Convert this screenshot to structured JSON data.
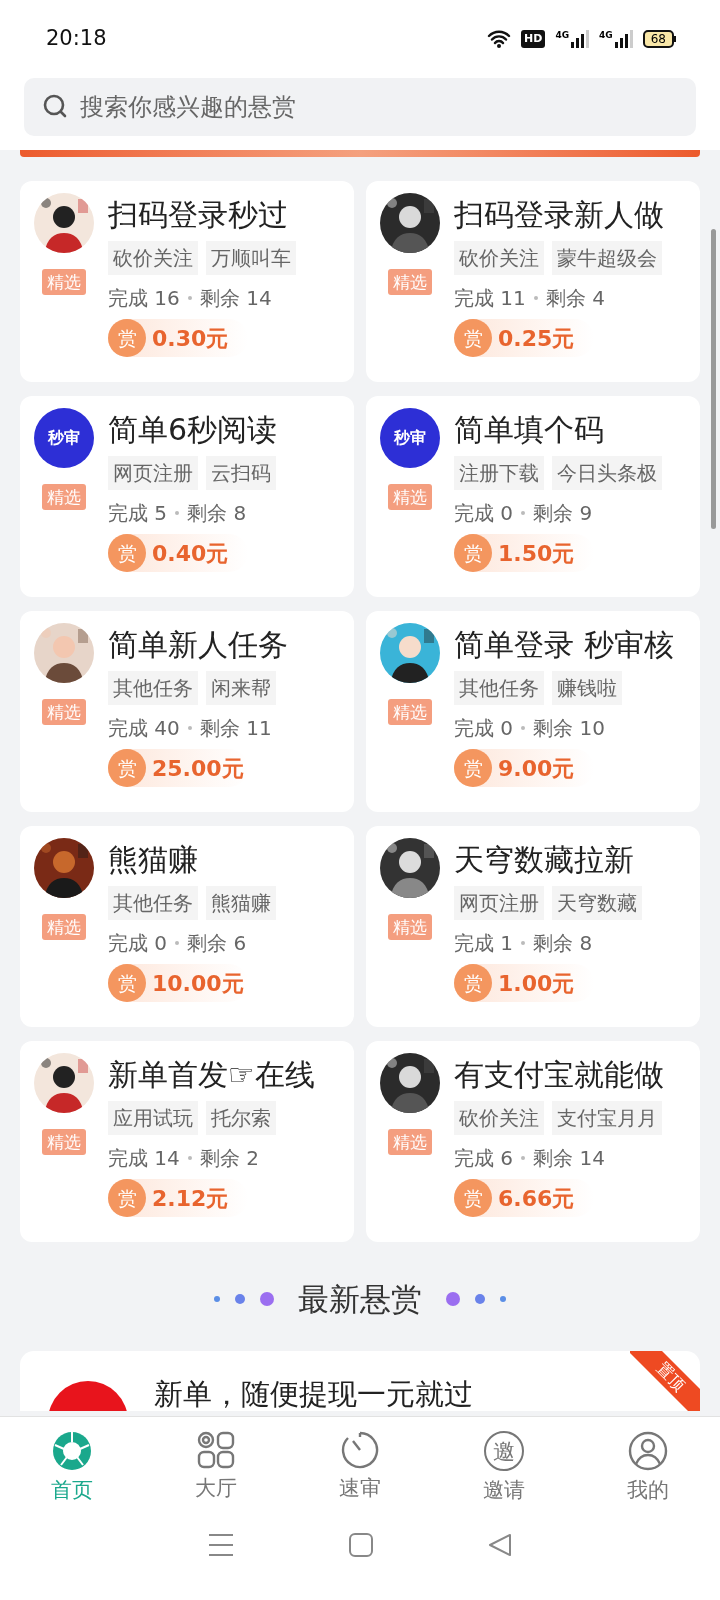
{
  "status_bar": {
    "time": "20:18",
    "battery": "68",
    "network_labels": [
      "4G",
      "4G"
    ],
    "hd_label": "HD"
  },
  "search": {
    "placeholder": "搜索你感兴趣的悬赏"
  },
  "cards": [
    {
      "title": "扫码登录秒过",
      "tags": [
        "砍价关注",
        "万顺叫车"
      ],
      "badge": "精选",
      "done": "完成 16",
      "remaining": "剩余 14",
      "reward_icon": "赏",
      "reward": "0.30元"
    },
    {
      "title": "扫码登录新人做",
      "tags": [
        "砍价关注",
        "蒙牛超级会"
      ],
      "badge": "精选",
      "done": "完成 11",
      "remaining": "剩余 4",
      "reward_icon": "赏",
      "reward": "0.25元"
    },
    {
      "avatar": {
        "kind": "text",
        "text": "秒审"
      },
      "title": "简单6秒阅读",
      "tags": [
        "网页注册",
        "云扫码"
      ],
      "badge": "精选",
      "done": "完成 5",
      "remaining": "剩余 8",
      "reward_icon": "赏",
      "reward": "0.40元"
    },
    {
      "avatar": {
        "kind": "text",
        "text": "秒审"
      },
      "title": "简单填个码",
      "tags": [
        "注册下载",
        "今日头条极"
      ],
      "badge": "精选",
      "done": "完成 0",
      "remaining": "剩余 9",
      "reward_icon": "赏",
      "reward": "1.50元"
    },
    {
      "title": "简单新人任务",
      "tags": [
        "其他任务",
        "闲来帮"
      ],
      "badge": "精选",
      "done": "完成 40",
      "remaining": "剩余 11",
      "reward_icon": "赏",
      "reward": "25.00元"
    },
    {
      "title": "简单登录 秒审核",
      "tags": [
        "其他任务",
        "赚钱啦"
      ],
      "badge": "精选",
      "done": "完成 0",
      "remaining": "剩余 10",
      "reward_icon": "赏",
      "reward": "9.00元"
    },
    {
      "title": "熊猫赚",
      "tags": [
        "其他任务",
        "熊猫赚"
      ],
      "badge": "精选",
      "done": "完成 0",
      "remaining": "剩余 6",
      "reward_icon": "赏",
      "reward": "10.00元"
    },
    {
      "title": "天穹数藏拉新",
      "tags": [
        "网页注册",
        "天穹数藏"
      ],
      "badge": "精选",
      "done": "完成 1",
      "remaining": "剩余 8",
      "reward_icon": "赏",
      "reward": "1.00元"
    },
    {
      "title": "新单首发☞在线",
      "tags": [
        "应用试玩",
        "托尔索"
      ],
      "badge": "精选",
      "done": "完成 14",
      "remaining": "剩余 2",
      "reward_icon": "赏",
      "reward": "2.12元"
    },
    {
      "title": "有支付宝就能做",
      "tags": [
        "砍价关注",
        "支付宝月月"
      ],
      "badge": "精选",
      "done": "完成 6",
      "remaining": "剩余 14",
      "reward_icon": "赏",
      "reward": "6.66元"
    }
  ],
  "section_title": "最新悬赏",
  "latest": {
    "title": "新单，随便提现一元就过",
    "ribbon": "置顶"
  },
  "nav": [
    {
      "label": "首页",
      "kind": "home",
      "selected": true
    },
    {
      "label": "大厅",
      "kind": "grid",
      "selected": false
    },
    {
      "label": "速审",
      "kind": "timer",
      "selected": false
    },
    {
      "label": "邀请",
      "kind": "invite",
      "icon_text": "邀",
      "selected": false
    },
    {
      "label": "我的",
      "kind": "user",
      "selected": false
    }
  ]
}
